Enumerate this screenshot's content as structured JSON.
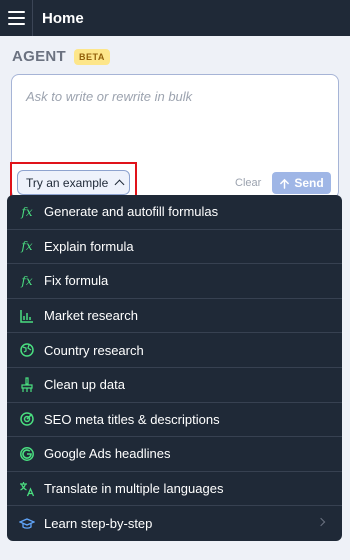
{
  "header": {
    "title": "Home",
    "menu_icon": "hamburger-icon"
  },
  "agent": {
    "label": "AGENT",
    "badge": "BETA"
  },
  "input": {
    "placeholder": "Ask to write or rewrite in bulk"
  },
  "actions": {
    "try_label": "Try an example",
    "clear_label": "Clear",
    "send_label": "Send"
  },
  "menu": {
    "items": [
      {
        "label": "Generate and autofill formulas",
        "icon": "formula-icon"
      },
      {
        "label": "Explain formula",
        "icon": "formula-icon"
      },
      {
        "label": "Fix formula",
        "icon": "formula-icon"
      },
      {
        "label": "Market research",
        "icon": "chart-icon"
      },
      {
        "label": "Country research",
        "icon": "globe-icon"
      },
      {
        "label": "Clean up data",
        "icon": "broom-icon"
      },
      {
        "label": "SEO meta titles & descriptions",
        "icon": "target-icon"
      },
      {
        "label": "Google Ads headlines",
        "icon": "google-icon"
      },
      {
        "label": "Translate in multiple languages",
        "icon": "translate-icon"
      },
      {
        "label": "Learn step-by-step",
        "icon": "graduation-cap-icon"
      }
    ]
  },
  "colors": {
    "header_bg": "#1f2937",
    "accent": "#4ade80",
    "send_bg": "#9fb6e6",
    "highlight": "#e0131a"
  }
}
